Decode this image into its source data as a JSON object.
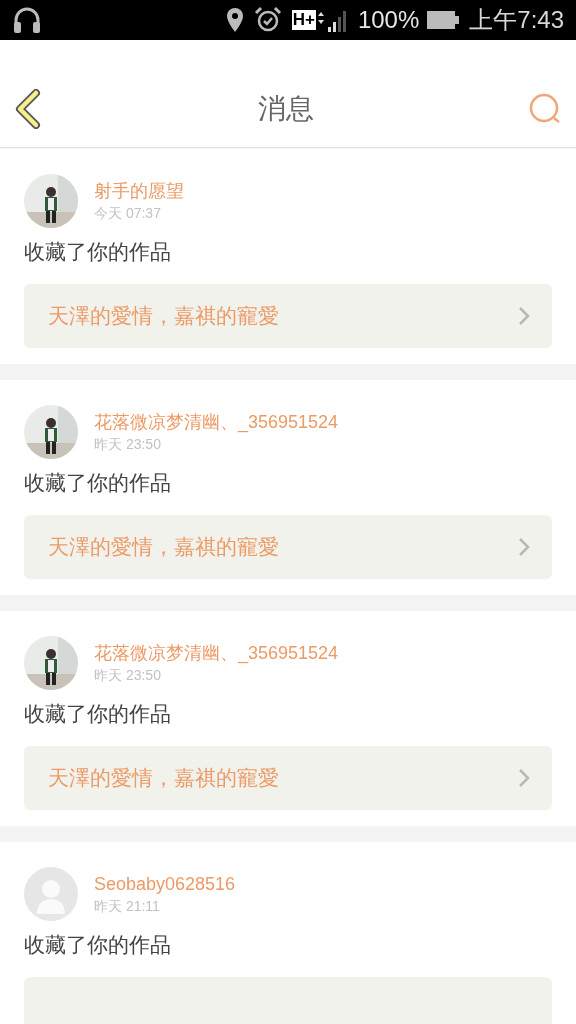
{
  "status_bar": {
    "network": "H+",
    "battery": "100%",
    "time": "上午7:43"
  },
  "header": {
    "title": "消息"
  },
  "messages": [
    {
      "user": "射手的愿望",
      "time": "今天 07:37",
      "action": "收藏了你的作品",
      "work": "天澤的愛情，嘉祺的寵愛"
    },
    {
      "user": "花落微凉梦清幽、_356951524",
      "time": "昨天 23:50",
      "action": "收藏了你的作品",
      "work": "天澤的愛情，嘉祺的寵愛"
    },
    {
      "user": "花落微凉梦清幽、_356951524",
      "time": "昨天 23:50",
      "action": "收藏了你的作品",
      "work": "天澤的愛情，嘉祺的寵愛"
    },
    {
      "user": "Seobaby0628516",
      "time": "昨天 21:11",
      "avatar": {
        "kind": "default"
      },
      "action": "收藏了你的作品"
    }
  ]
}
